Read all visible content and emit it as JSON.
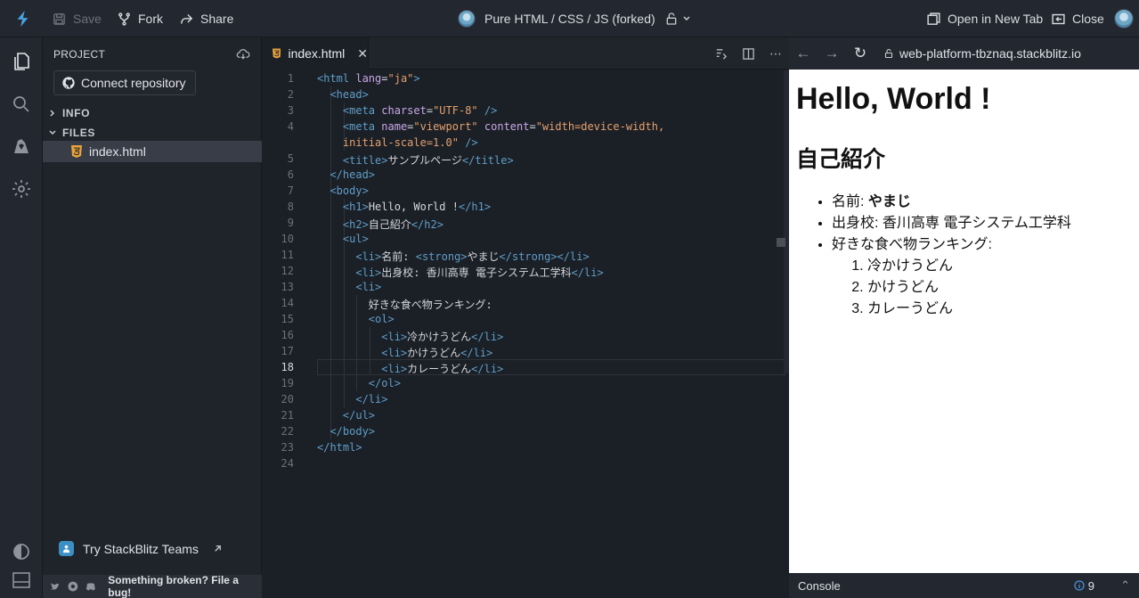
{
  "topbar": {
    "save_label": "Save",
    "fork_label": "Fork",
    "share_label": "Share",
    "project_title": "Pure HTML / CSS / JS (forked)",
    "open_new_tab_label": "Open in New Tab",
    "close_label": "Close"
  },
  "sidebar": {
    "header": "PROJECT",
    "connect_label": "Connect repository",
    "info_label": "INFO",
    "files_label": "FILES",
    "file_name": "index.html",
    "teams_label": "Try StackBlitz Teams",
    "bug_label": "Something broken? File a bug!"
  },
  "editor": {
    "tab_label": "index.html",
    "active_line": 18,
    "lines": [
      {
        "n": "1",
        "html": "<span class='tg'>&lt;html</span> <span class='at'>lang</span>=<span class='st'>\"ja\"</span><span class='tg'>&gt;</span>"
      },
      {
        "n": "2",
        "html": "  <span class='tg'>&lt;head&gt;</span>"
      },
      {
        "n": "3",
        "html": "    <span class='tg'>&lt;meta</span> <span class='at'>charset</span>=<span class='st'>\"UTF-8\"</span> <span class='tg'>/&gt;</span>"
      },
      {
        "n": "4",
        "html": "    <span class='tg'>&lt;meta</span> <span class='at'>name</span>=<span class='st'>\"viewport\"</span> <span class='at'>content</span>=<span class='st'>\"width=device-width,</span>"
      },
      {
        "n": "",
        "html": "    <span class='st'>initial-scale=1.0\"</span> <span class='tg'>/&gt;</span>"
      },
      {
        "n": "5",
        "html": "    <span class='tg'>&lt;title&gt;</span>サンプルページ<span class='tg'>&lt;/title&gt;</span>"
      },
      {
        "n": "6",
        "html": "  <span class='tg'>&lt;/head&gt;</span>"
      },
      {
        "n": "7",
        "html": "  <span class='tg'>&lt;body&gt;</span>"
      },
      {
        "n": "8",
        "html": "    <span class='tg'>&lt;h1&gt;</span>Hello, World !<span class='tg'>&lt;/h1&gt;</span>"
      },
      {
        "n": "9",
        "html": "    <span class='tg'>&lt;h2&gt;</span>自己紹介<span class='tg'>&lt;/h2&gt;</span>"
      },
      {
        "n": "10",
        "html": "    <span class='tg'>&lt;ul&gt;</span>"
      },
      {
        "n": "11",
        "html": "      <span class='tg'>&lt;li&gt;</span>名前: <span class='tg'>&lt;strong&gt;</span>やまじ<span class='tg'>&lt;/strong&gt;&lt;/li&gt;</span>"
      },
      {
        "n": "12",
        "html": "      <span class='tg'>&lt;li&gt;</span>出身校: 香川高専 電子システム工学科<span class='tg'>&lt;/li&gt;</span>"
      },
      {
        "n": "13",
        "html": "      <span class='tg'>&lt;li&gt;</span>"
      },
      {
        "n": "14",
        "html": "        好きな食べ物ランキング:"
      },
      {
        "n": "15",
        "html": "        <span class='tg'>&lt;ol&gt;</span>"
      },
      {
        "n": "16",
        "html": "          <span class='tg'>&lt;li&gt;</span>冷かけうどん<span class='tg'>&lt;/li&gt;</span>"
      },
      {
        "n": "17",
        "html": "          <span class='tg'>&lt;li&gt;</span>かけうどん<span class='tg'>&lt;/li&gt;</span>"
      },
      {
        "n": "18",
        "html": "          <span class='tg'>&lt;li&gt;</span>カレーうどん<span class='tg'>&lt;/li&gt;</span>"
      },
      {
        "n": "19",
        "html": "        <span class='tg'>&lt;/ol&gt;</span>"
      },
      {
        "n": "20",
        "html": "      <span class='tg'>&lt;/li&gt;</span>"
      },
      {
        "n": "21",
        "html": "    <span class='tg'>&lt;/ul&gt;</span>"
      },
      {
        "n": "22",
        "html": "  <span class='tg'>&lt;/body&gt;</span>"
      },
      {
        "n": "23",
        "html": "<span class='tg'>&lt;/html&gt;</span>"
      },
      {
        "n": "24",
        "html": ""
      }
    ]
  },
  "preview": {
    "url": "web-platform-tbznaq.stackblitz.io",
    "h1": "Hello, World !",
    "h2": "自己紹介",
    "name_label": "名前: ",
    "name_value": "やまじ",
    "school": "出身校: 香川高専 電子システム工学科",
    "food_label": "好きな食べ物ランキング:",
    "foods": [
      "冷かけうどん",
      "かけうどん",
      "カレーうどん"
    ],
    "console_label": "Console",
    "console_count": "9"
  },
  "colors": {
    "accent": "#3b8fc4",
    "tag": "#5f9ec9",
    "attr": "#c9a7e7",
    "string": "#e5a06e"
  }
}
